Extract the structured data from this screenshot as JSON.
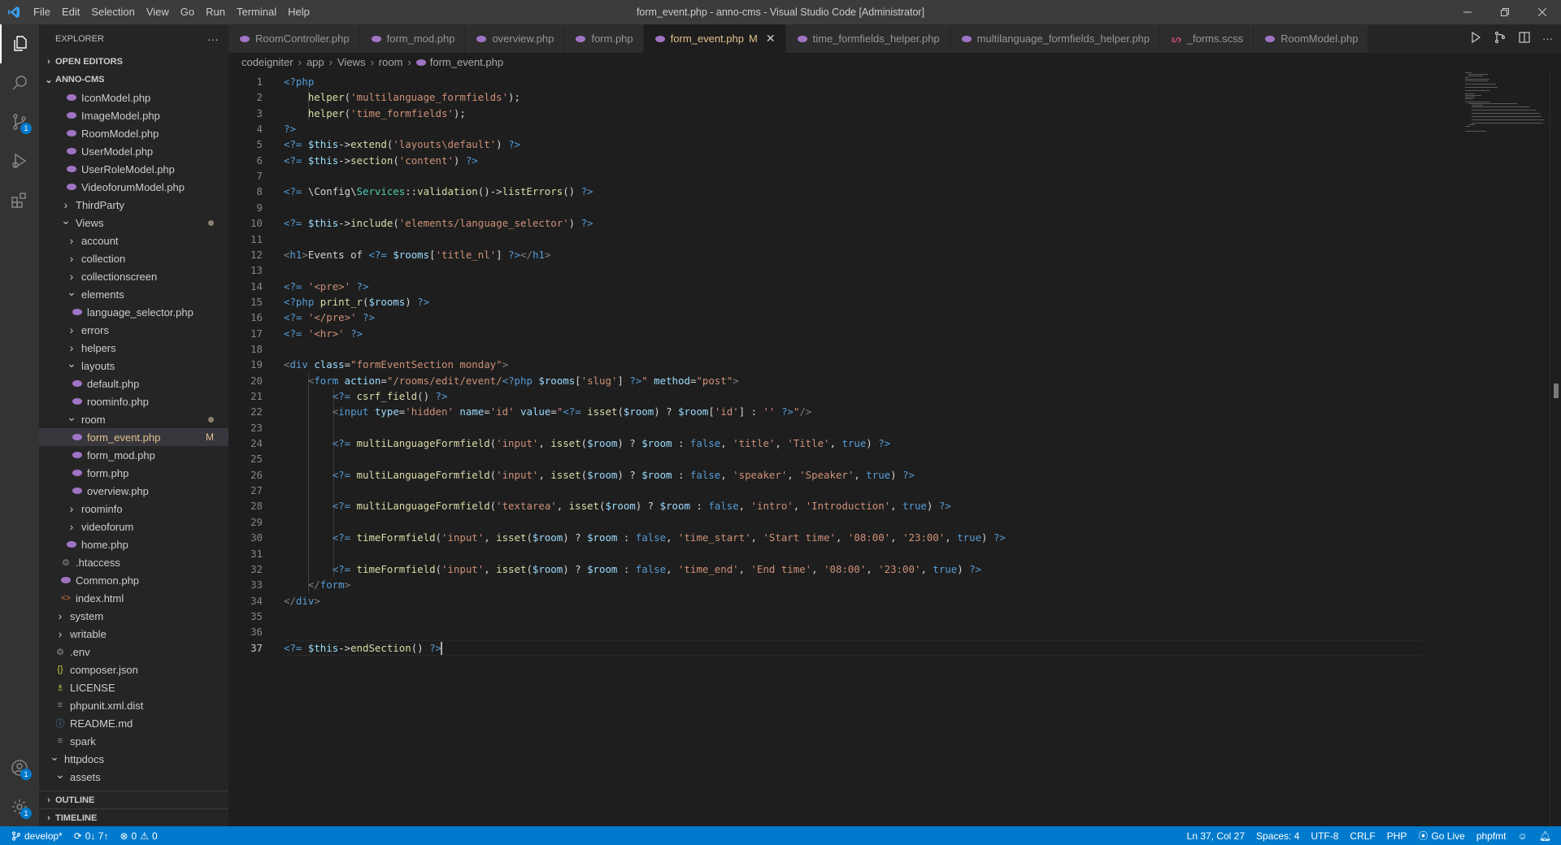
{
  "window": {
    "title": "form_event.php - anno-cms - Visual Studio Code [Administrator]",
    "menu": [
      "File",
      "Edit",
      "Selection",
      "View",
      "Go",
      "Run",
      "Terminal",
      "Help"
    ]
  },
  "activity": {
    "source_control_badge": "1",
    "accounts_badge": "1",
    "settings_badge": "1"
  },
  "sidebar": {
    "title": "EXPLORER",
    "more": "···",
    "open_editors": "OPEN EDITORS",
    "project": "ANNO-CMS",
    "items": [
      {
        "label": "IconModel.php",
        "icon": "php",
        "indent": 0
      },
      {
        "label": "ImageModel.php",
        "icon": "php",
        "indent": 0
      },
      {
        "label": "RoomModel.php",
        "icon": "php",
        "indent": 0
      },
      {
        "label": "UserModel.php",
        "icon": "php",
        "indent": 0
      },
      {
        "label": "UserRoleModel.php",
        "icon": "php",
        "indent": 0
      },
      {
        "label": "VideoforumModel.php",
        "icon": "php",
        "indent": 0
      },
      {
        "label": "ThirdParty",
        "icon": "folder-closed",
        "indent": -1
      },
      {
        "label": "Views",
        "icon": "folder-open",
        "indent": -1,
        "dot": true
      },
      {
        "label": "account",
        "icon": "folder-closed",
        "indent": 0
      },
      {
        "label": "collection",
        "icon": "folder-closed",
        "indent": 0
      },
      {
        "label": "collectionscreen",
        "icon": "folder-closed",
        "indent": 0
      },
      {
        "label": "elements",
        "icon": "folder-open",
        "indent": 0
      },
      {
        "label": "language_selector.php",
        "icon": "php",
        "indent": 1
      },
      {
        "label": "errors",
        "icon": "folder-closed",
        "indent": 0
      },
      {
        "label": "helpers",
        "icon": "folder-closed",
        "indent": 0
      },
      {
        "label": "layouts",
        "icon": "folder-open",
        "indent": 0
      },
      {
        "label": "default.php",
        "icon": "php",
        "indent": 1
      },
      {
        "label": "roominfo.php",
        "icon": "php",
        "indent": 1
      },
      {
        "label": "room",
        "icon": "folder-open",
        "indent": 0,
        "dot": true
      },
      {
        "label": "form_event.php",
        "icon": "php",
        "indent": 1,
        "selected": true,
        "flag": "M"
      },
      {
        "label": "form_mod.php",
        "icon": "php",
        "indent": 1
      },
      {
        "label": "form.php",
        "icon": "php",
        "indent": 1
      },
      {
        "label": "overview.php",
        "icon": "php",
        "indent": 1
      },
      {
        "label": "roominfo",
        "icon": "folder-closed",
        "indent": 0
      },
      {
        "label": "videoforum",
        "icon": "folder-closed",
        "indent": 0
      },
      {
        "label": "home.php",
        "icon": "php",
        "indent": 0
      },
      {
        "label": ".htaccess",
        "icon": "gear",
        "indent": -1
      },
      {
        "label": "Common.php",
        "icon": "php",
        "indent": -1
      },
      {
        "label": "index.html",
        "icon": "html",
        "indent": -1
      },
      {
        "label": "system",
        "icon": "folder-closed",
        "indent": -2
      },
      {
        "label": "writable",
        "icon": "folder-closed",
        "indent": -2
      },
      {
        "label": ".env",
        "icon": "gear",
        "indent": -2
      },
      {
        "label": "composer.json",
        "icon": "json",
        "indent": -2
      },
      {
        "label": "LICENSE",
        "icon": "license",
        "indent": -2
      },
      {
        "label": "phpunit.xml.dist",
        "icon": "lines",
        "indent": -2
      },
      {
        "label": "README.md",
        "icon": "info",
        "indent": -2
      },
      {
        "label": "spark",
        "icon": "lines",
        "indent": -2
      },
      {
        "label": "httpdocs",
        "icon": "folder-open",
        "indent": -3
      },
      {
        "label": "assets",
        "icon": "folder-open",
        "indent": -2
      }
    ],
    "outline": "OUTLINE",
    "timeline": "TIMELINE"
  },
  "tabs": [
    {
      "label": "RoomController.php",
      "active": false
    },
    {
      "label": "form_mod.php",
      "active": false
    },
    {
      "label": "overview.php",
      "active": false
    },
    {
      "label": "form.php",
      "active": false
    },
    {
      "label": "form_event.php",
      "active": true,
      "flag": "M"
    },
    {
      "label": "time_formfields_helper.php",
      "active": false
    },
    {
      "label": "multilanguage_formfields_helper.php",
      "active": false
    },
    {
      "label": "_forms.scss",
      "active": false,
      "icon": "scss"
    },
    {
      "label": "RoomModel.php",
      "active": false
    }
  ],
  "breadcrumb": [
    "codeigniter",
    "app",
    "Views",
    "room",
    "form_event.php"
  ],
  "code": [
    [
      [
        "k",
        "<?php"
      ]
    ],
    [
      [
        "",
        "    "
      ],
      [
        "f",
        "helper"
      ],
      [
        "",
        "("
      ],
      [
        "s",
        "'multilanguage_formfields'"
      ],
      [
        "",
        ");"
      ]
    ],
    [
      [
        "",
        "    "
      ],
      [
        "f",
        "helper"
      ],
      [
        "",
        "("
      ],
      [
        "s",
        "'time_formfields'"
      ],
      [
        "",
        ");"
      ]
    ],
    [
      [
        "k",
        "?>"
      ]
    ],
    [
      [
        "k",
        "<?="
      ],
      [
        "",
        " "
      ],
      [
        "v",
        "$this"
      ],
      [
        "",
        "->"
      ],
      [
        "f",
        "extend"
      ],
      [
        "",
        "("
      ],
      [
        "s",
        "'layouts\\default'"
      ],
      [
        "",
        ") "
      ],
      [
        "k",
        "?>"
      ]
    ],
    [
      [
        "k",
        "<?="
      ],
      [
        "",
        " "
      ],
      [
        "v",
        "$this"
      ],
      [
        "",
        "->"
      ],
      [
        "f",
        "section"
      ],
      [
        "",
        "("
      ],
      [
        "s",
        "'content'"
      ],
      [
        "",
        ") "
      ],
      [
        "k",
        "?>"
      ]
    ],
    [],
    [
      [
        "k",
        "<?="
      ],
      [
        "",
        " \\Config\\"
      ],
      [
        "t",
        "Services"
      ],
      [
        "",
        "::"
      ],
      [
        "f",
        "validation"
      ],
      [
        "",
        "()->"
      ],
      [
        "f",
        "listErrors"
      ],
      [
        "",
        "() "
      ],
      [
        "k",
        "?>"
      ]
    ],
    [],
    [
      [
        "k",
        "<?="
      ],
      [
        "",
        " "
      ],
      [
        "v",
        "$this"
      ],
      [
        "",
        "->"
      ],
      [
        "f",
        "include"
      ],
      [
        "",
        "("
      ],
      [
        "s",
        "'elements/language_selector'"
      ],
      [
        "",
        ") "
      ],
      [
        "k",
        "?>"
      ]
    ],
    [],
    [
      [
        "p",
        "<"
      ],
      [
        "k",
        "h1"
      ],
      [
        "p",
        ">"
      ],
      [
        "",
        "Events of "
      ],
      [
        "k",
        "<?="
      ],
      [
        "",
        " "
      ],
      [
        "v",
        "$rooms"
      ],
      [
        "",
        "["
      ],
      [
        "s",
        "'title_nl'"
      ],
      [
        "",
        "] "
      ],
      [
        "k",
        "?>"
      ],
      [
        "p",
        "</"
      ],
      [
        "k",
        "h1"
      ],
      [
        "p",
        ">"
      ]
    ],
    [],
    [
      [
        "k",
        "<?="
      ],
      [
        "",
        " "
      ],
      [
        "s",
        "'<pre>'"
      ],
      [
        "",
        " "
      ],
      [
        "k",
        "?>"
      ]
    ],
    [
      [
        "k",
        "<?php"
      ],
      [
        "",
        " "
      ],
      [
        "f",
        "print_r"
      ],
      [
        "",
        "("
      ],
      [
        "v",
        "$rooms"
      ],
      [
        "",
        ") "
      ],
      [
        "k",
        "?>"
      ]
    ],
    [
      [
        "k",
        "<?="
      ],
      [
        "",
        " "
      ],
      [
        "s",
        "'</pre>'"
      ],
      [
        "",
        " "
      ],
      [
        "k",
        "?>"
      ]
    ],
    [
      [
        "k",
        "<?="
      ],
      [
        "",
        " "
      ],
      [
        "s",
        "'<hr>'"
      ],
      [
        "",
        " "
      ],
      [
        "k",
        "?>"
      ]
    ],
    [],
    [
      [
        "p",
        "<"
      ],
      [
        "k",
        "div"
      ],
      [
        "",
        " "
      ],
      [
        "v",
        "class"
      ],
      [
        "",
        "="
      ],
      [
        "s",
        "\"formEventSection monday\""
      ],
      [
        "p",
        ">"
      ]
    ],
    [
      [
        "",
        "    "
      ],
      [
        "p",
        "<"
      ],
      [
        "k",
        "form"
      ],
      [
        "",
        " "
      ],
      [
        "v",
        "action"
      ],
      [
        "",
        "="
      ],
      [
        "s",
        "\"/rooms/edit/event/"
      ],
      [
        "k",
        "<?php"
      ],
      [
        "",
        " "
      ],
      [
        "v",
        "$rooms"
      ],
      [
        "",
        "["
      ],
      [
        "s",
        "'slug'"
      ],
      [
        "",
        "] "
      ],
      [
        "k",
        "?>"
      ],
      [
        "s",
        "\""
      ],
      [
        "",
        " "
      ],
      [
        "v",
        "method"
      ],
      [
        "",
        "="
      ],
      [
        "s",
        "\"post\""
      ],
      [
        "p",
        ">"
      ]
    ],
    [
      [
        "",
        "        "
      ],
      [
        "k",
        "<?="
      ],
      [
        "",
        " "
      ],
      [
        "f",
        "csrf_field"
      ],
      [
        "",
        "() "
      ],
      [
        "k",
        "?>"
      ]
    ],
    [
      [
        "",
        "        "
      ],
      [
        "p",
        "<"
      ],
      [
        "k",
        "input"
      ],
      [
        "",
        " "
      ],
      [
        "v",
        "type"
      ],
      [
        "",
        "="
      ],
      [
        "s",
        "'hidden'"
      ],
      [
        "",
        " "
      ],
      [
        "v",
        "name"
      ],
      [
        "",
        "="
      ],
      [
        "s",
        "'id'"
      ],
      [
        "",
        " "
      ],
      [
        "v",
        "value"
      ],
      [
        "",
        "="
      ],
      [
        "s",
        "\""
      ],
      [
        "k",
        "<?="
      ],
      [
        "",
        " "
      ],
      [
        "f",
        "isset"
      ],
      [
        "",
        "("
      ],
      [
        "v",
        "$room"
      ],
      [
        "",
        ") ? "
      ],
      [
        "v",
        "$room"
      ],
      [
        "",
        "["
      ],
      [
        "s",
        "'id'"
      ],
      [
        "",
        "] : "
      ],
      [
        "s",
        "''"
      ],
      [
        "",
        " "
      ],
      [
        "k",
        "?>"
      ],
      [
        "s",
        "\""
      ],
      [
        "p",
        "/>"
      ]
    ],
    [],
    [
      [
        "",
        "        "
      ],
      [
        "k",
        "<?="
      ],
      [
        "",
        " "
      ],
      [
        "f",
        "multiLanguageFormfield"
      ],
      [
        "",
        "("
      ],
      [
        "s",
        "'input'"
      ],
      [
        "",
        ", "
      ],
      [
        "f",
        "isset"
      ],
      [
        "",
        "("
      ],
      [
        "v",
        "$room"
      ],
      [
        "",
        ") ? "
      ],
      [
        "v",
        "$room"
      ],
      [
        "",
        " : "
      ],
      [
        "k",
        "false"
      ],
      [
        "",
        ", "
      ],
      [
        "s",
        "'title'"
      ],
      [
        "",
        ", "
      ],
      [
        "s",
        "'Title'"
      ],
      [
        "",
        ", "
      ],
      [
        "k",
        "true"
      ],
      [
        "",
        ") "
      ],
      [
        "k",
        "?>"
      ]
    ],
    [],
    [
      [
        "",
        "        "
      ],
      [
        "k",
        "<?="
      ],
      [
        "",
        " "
      ],
      [
        "f",
        "multiLanguageFormfield"
      ],
      [
        "",
        "("
      ],
      [
        "s",
        "'input'"
      ],
      [
        "",
        ", "
      ],
      [
        "f",
        "isset"
      ],
      [
        "",
        "("
      ],
      [
        "v",
        "$room"
      ],
      [
        "",
        ") ? "
      ],
      [
        "v",
        "$room"
      ],
      [
        "",
        " : "
      ],
      [
        "k",
        "false"
      ],
      [
        "",
        ", "
      ],
      [
        "s",
        "'speaker'"
      ],
      [
        "",
        ", "
      ],
      [
        "s",
        "'Speaker'"
      ],
      [
        "",
        ", "
      ],
      [
        "k",
        "true"
      ],
      [
        "",
        ") "
      ],
      [
        "k",
        "?>"
      ]
    ],
    [],
    [
      [
        "",
        "        "
      ],
      [
        "k",
        "<?="
      ],
      [
        "",
        " "
      ],
      [
        "f",
        "multiLanguageFormfield"
      ],
      [
        "",
        "("
      ],
      [
        "s",
        "'textarea'"
      ],
      [
        "",
        ", "
      ],
      [
        "f",
        "isset"
      ],
      [
        "",
        "("
      ],
      [
        "v",
        "$room"
      ],
      [
        "",
        ") ? "
      ],
      [
        "v",
        "$room"
      ],
      [
        "",
        " : "
      ],
      [
        "k",
        "false"
      ],
      [
        "",
        ", "
      ],
      [
        "s",
        "'intro'"
      ],
      [
        "",
        ", "
      ],
      [
        "s",
        "'Introduction'"
      ],
      [
        "",
        ", "
      ],
      [
        "k",
        "true"
      ],
      [
        "",
        ") "
      ],
      [
        "k",
        "?>"
      ]
    ],
    [],
    [
      [
        "",
        "        "
      ],
      [
        "k",
        "<?="
      ],
      [
        "",
        " "
      ],
      [
        "f",
        "timeFormfield"
      ],
      [
        "",
        "("
      ],
      [
        "s",
        "'input'"
      ],
      [
        "",
        ", "
      ],
      [
        "f",
        "isset"
      ],
      [
        "",
        "("
      ],
      [
        "v",
        "$room"
      ],
      [
        "",
        ") ? "
      ],
      [
        "v",
        "$room"
      ],
      [
        "",
        " : "
      ],
      [
        "k",
        "false"
      ],
      [
        "",
        ", "
      ],
      [
        "s",
        "'time_start'"
      ],
      [
        "",
        ", "
      ],
      [
        "s",
        "'Start time'"
      ],
      [
        "",
        ", "
      ],
      [
        "s",
        "'08:00'"
      ],
      [
        "",
        ", "
      ],
      [
        "s",
        "'23:00'"
      ],
      [
        "",
        ", "
      ],
      [
        "k",
        "true"
      ],
      [
        "",
        ") "
      ],
      [
        "k",
        "?>"
      ]
    ],
    [],
    [
      [
        "",
        "        "
      ],
      [
        "k",
        "<?="
      ],
      [
        "",
        " "
      ],
      [
        "f",
        "timeFormfield"
      ],
      [
        "",
        "("
      ],
      [
        "s",
        "'input'"
      ],
      [
        "",
        ", "
      ],
      [
        "f",
        "isset"
      ],
      [
        "",
        "("
      ],
      [
        "v",
        "$room"
      ],
      [
        "",
        ") ? "
      ],
      [
        "v",
        "$room"
      ],
      [
        "",
        " : "
      ],
      [
        "k",
        "false"
      ],
      [
        "",
        ", "
      ],
      [
        "s",
        "'time_end'"
      ],
      [
        "",
        ", "
      ],
      [
        "s",
        "'End time'"
      ],
      [
        "",
        ", "
      ],
      [
        "s",
        "'08:00'"
      ],
      [
        "",
        ", "
      ],
      [
        "s",
        "'23:00'"
      ],
      [
        "",
        ", "
      ],
      [
        "k",
        "true"
      ],
      [
        "",
        ") "
      ],
      [
        "k",
        "?>"
      ]
    ],
    [
      [
        "",
        "    "
      ],
      [
        "p",
        "</"
      ],
      [
        "k",
        "form"
      ],
      [
        "p",
        ">"
      ]
    ],
    [
      [
        "p",
        "</"
      ],
      [
        "k",
        "div"
      ],
      [
        "p",
        ">"
      ]
    ],
    [],
    [],
    [
      [
        "k",
        "<?="
      ],
      [
        "",
        " "
      ],
      [
        "v",
        "$this"
      ],
      [
        "",
        "->"
      ],
      [
        "f",
        "endSection"
      ],
      [
        "",
        "() "
      ],
      [
        "k",
        "?>"
      ]
    ]
  ],
  "cursor_line": 37,
  "status": {
    "branch": "develop*",
    "sync": "0↓ 7↑",
    "errors": "0",
    "warnings": "0",
    "position": "Ln 37, Col 27",
    "spaces": "Spaces: 4",
    "encoding": "UTF-8",
    "eol": "CRLF",
    "language": "PHP",
    "golive": "Go Live",
    "formatter": "phpfmt"
  },
  "colors": {
    "accent": "#007acc",
    "php_icon": "#a074c4",
    "modified": "#e2c08d"
  }
}
